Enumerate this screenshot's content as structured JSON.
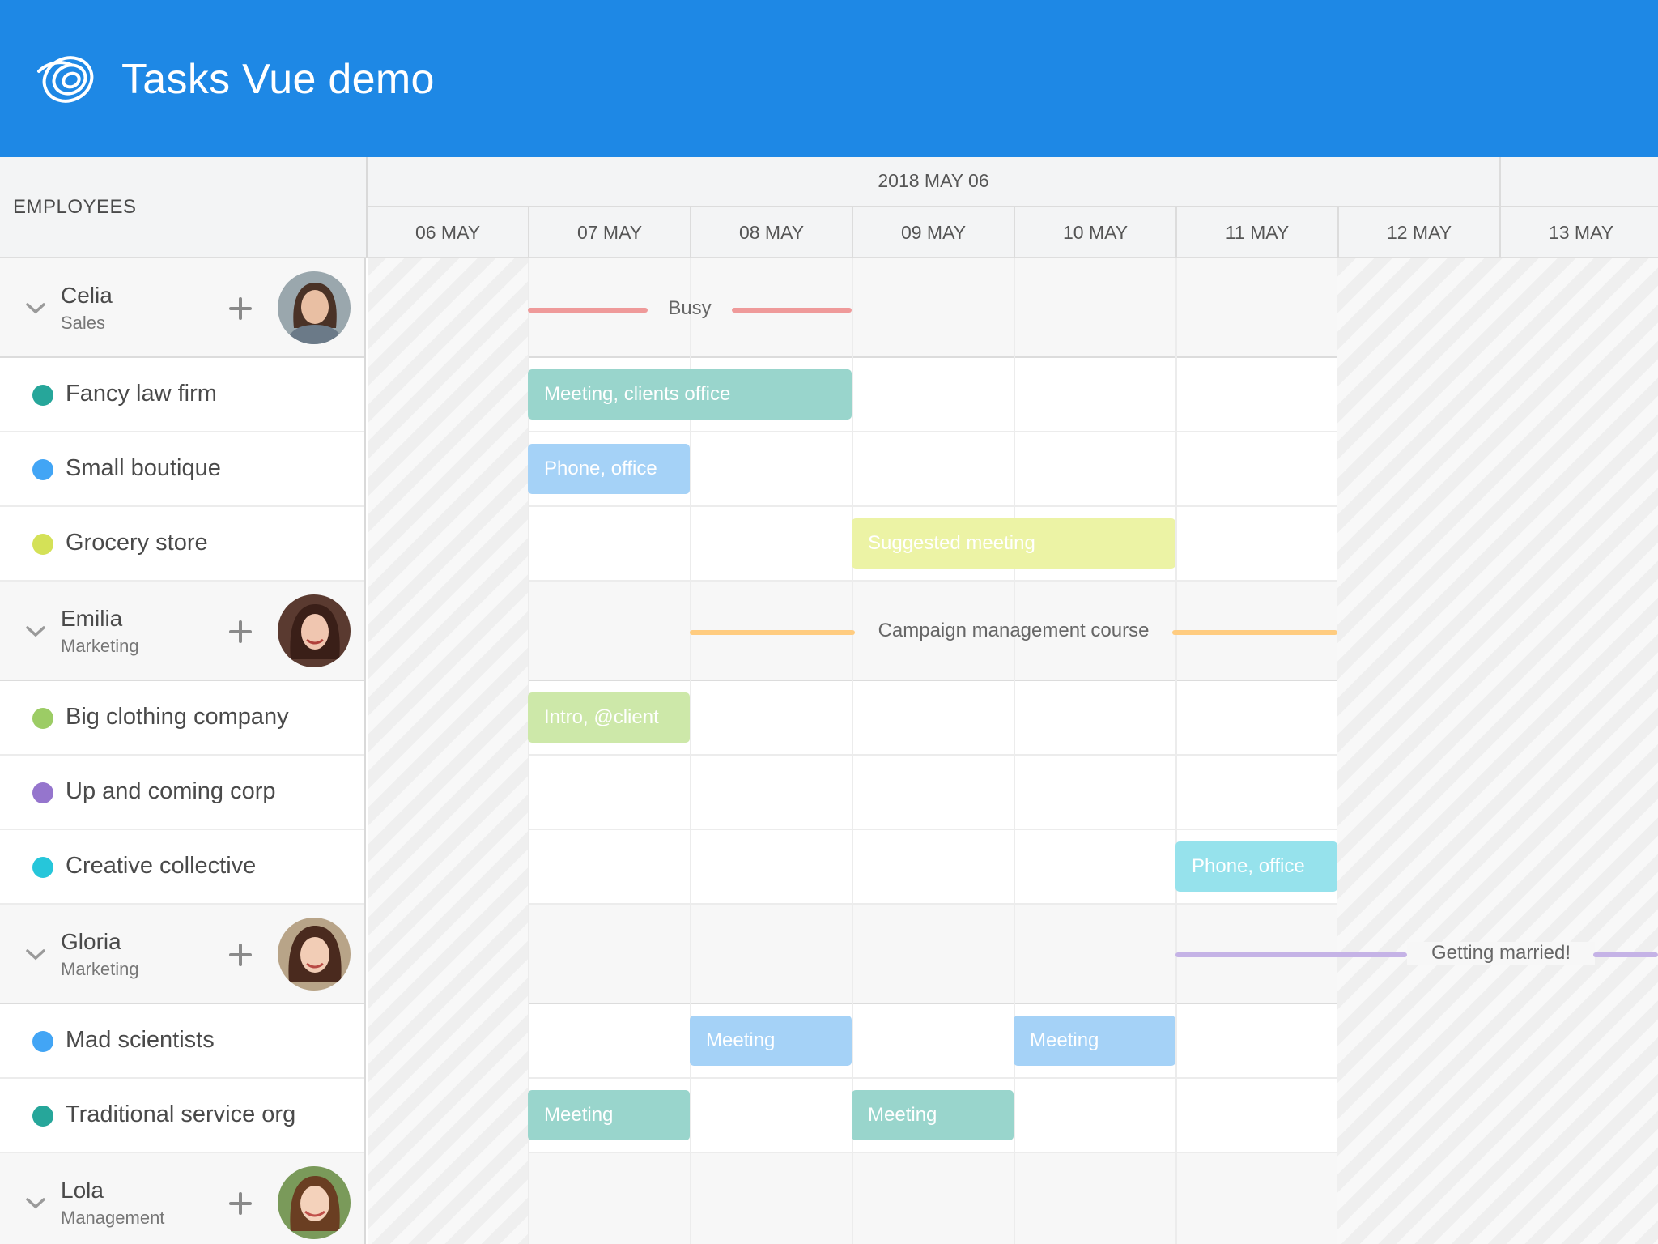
{
  "app": {
    "title": "Tasks Vue demo",
    "logo": "spiral-logo-icon"
  },
  "colors": {
    "header": "#1e88e5",
    "teal": "#26a69a",
    "blue": "#42a5f5",
    "yellow": "#d4e157",
    "green": "#9ccc65",
    "purple": "#9575cd",
    "cyan": "#26c6da",
    "busy": "#ef9a9a",
    "course": "#ffcc80",
    "married": "#c5b3e6"
  },
  "sidebar": {
    "header": "EMPLOYEES"
  },
  "timeline": {
    "week_label": "2018 MAY 06",
    "days": [
      "06 MAY",
      "07 MAY",
      "08 MAY",
      "09 MAY",
      "10 MAY",
      "11 MAY",
      "12 MAY",
      "13 MAY"
    ]
  },
  "employees": [
    {
      "name": "Celia",
      "role": "Sales",
      "avatar": "person-avatar-icon",
      "banner": {
        "text": "Busy",
        "color": "busy"
      },
      "resources": [
        {
          "name": "Fancy law firm",
          "color": "teal",
          "event": "Meeting, clients office"
        },
        {
          "name": "Small boutique",
          "color": "blue",
          "event": "Phone, office"
        },
        {
          "name": "Grocery store",
          "color": "yellow",
          "event": "Suggested meeting"
        }
      ]
    },
    {
      "name": "Emilia",
      "role": "Marketing",
      "avatar": "person-avatar-icon",
      "banner": {
        "text": "Campaign management course",
        "color": "course"
      },
      "resources": [
        {
          "name": "Big clothing company",
          "color": "green",
          "event": "Intro, @client"
        },
        {
          "name": "Up and coming corp",
          "color": "purple"
        },
        {
          "name": "Creative collective",
          "color": "cyan",
          "event": "Phone, office"
        }
      ]
    },
    {
      "name": "Gloria",
      "role": "Marketing",
      "avatar": "person-avatar-icon",
      "banner": {
        "text": "Getting married!",
        "color": "married"
      },
      "resources": [
        {
          "name": "Mad scientists",
          "color": "blue",
          "events": [
            "Meeting",
            "Meeting"
          ]
        },
        {
          "name": "Traditional service org",
          "color": "teal",
          "events": [
            "Meeting",
            "Meeting"
          ]
        }
      ]
    },
    {
      "name": "Lola",
      "role": "Management",
      "avatar": "person-avatar-icon"
    }
  ]
}
